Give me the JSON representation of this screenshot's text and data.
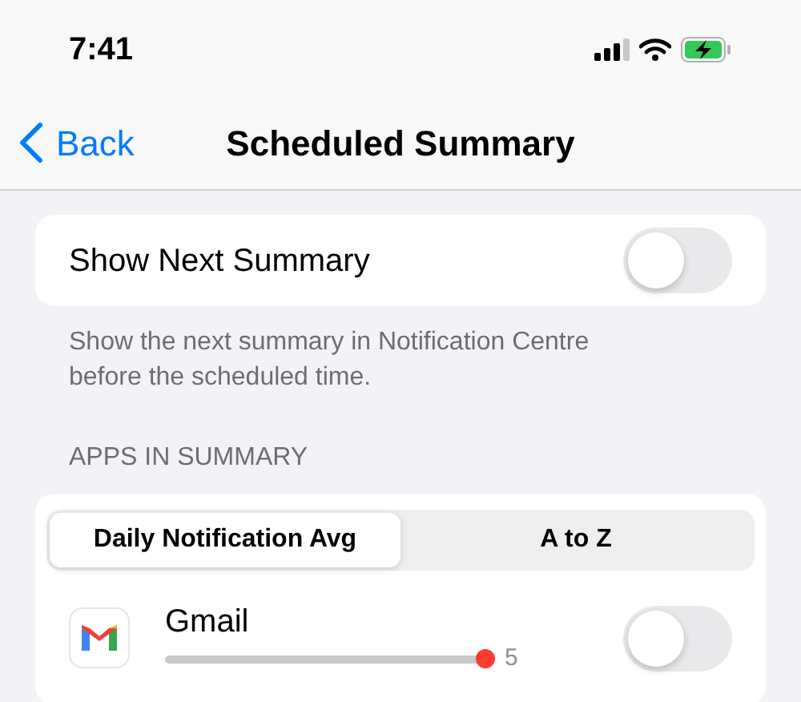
{
  "status_bar": {
    "time": "7:41"
  },
  "nav": {
    "back": "Back",
    "title": "Scheduled Summary"
  },
  "show_next": {
    "label": "Show Next Summary",
    "on": false
  },
  "show_next_footer": "Show the next summary in Notification Centre before the scheduled time.",
  "apps_header": "APPS IN SUMMARY",
  "sort_tabs": [
    {
      "label": "Daily Notification Avg",
      "selected": true
    },
    {
      "label": "A to Z",
      "selected": false
    }
  ],
  "apps": [
    {
      "name": "Gmail",
      "level": 1,
      "count": "5",
      "on": false
    }
  ]
}
